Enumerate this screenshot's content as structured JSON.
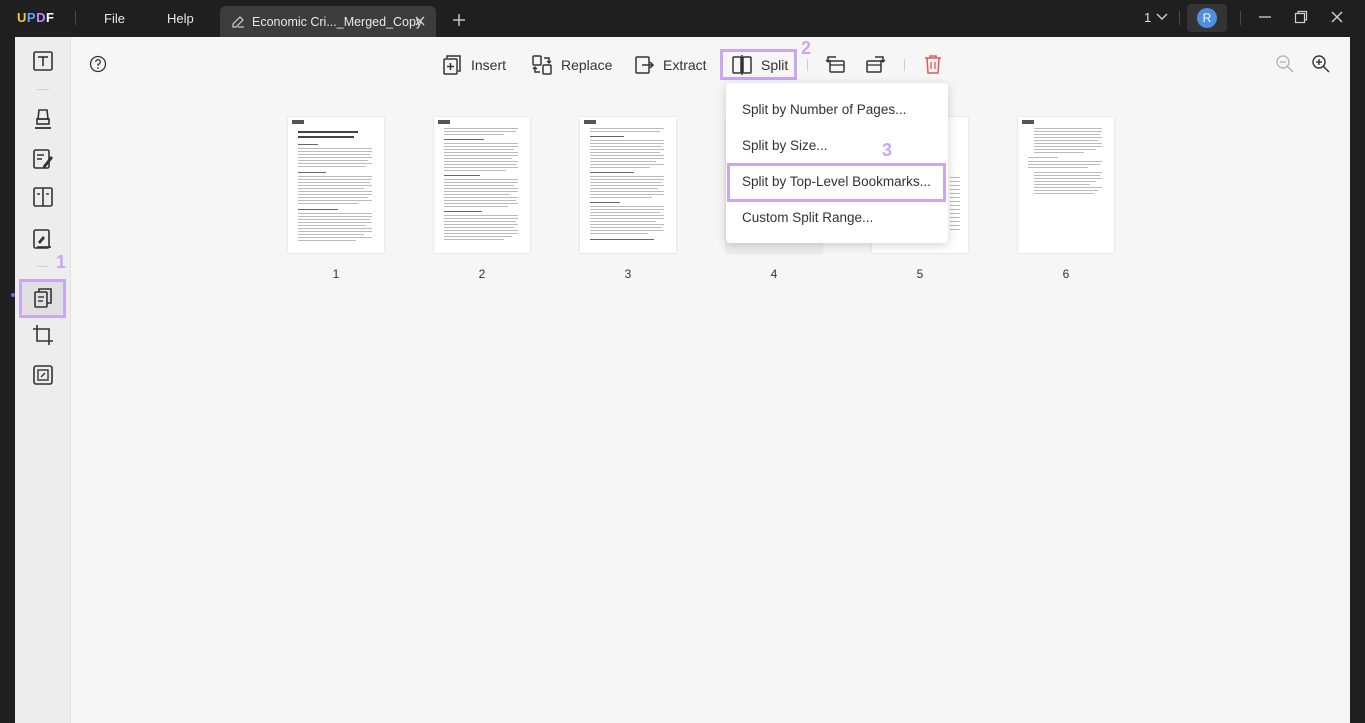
{
  "app": {
    "logo": [
      "U",
      "P",
      "D",
      "F"
    ]
  },
  "menu": {
    "file": "File",
    "help": "Help"
  },
  "tab": {
    "title": "Economic Cri..._Merged_Copy"
  },
  "window": {
    "page_count": "1",
    "avatar_letter": "R"
  },
  "toolbar": {
    "insert": "Insert",
    "replace": "Replace",
    "extract": "Extract",
    "split": "Split"
  },
  "split_menu": {
    "items": [
      "Split by Number of Pages...",
      "Split by Size...",
      "Split by Top-Level Bookmarks...",
      "Custom Split Range..."
    ]
  },
  "pages": [
    "1",
    "2",
    "3",
    "4",
    "5",
    "6"
  ],
  "page1": {
    "title": "Economic Crises of Bangladesh: Challenges and Opportunities"
  },
  "annotations": {
    "step1": "1",
    "step2": "2",
    "step3": "3"
  },
  "colors": {
    "highlight": "#c9a7f3",
    "accent": "#8a5cf0",
    "avatar": "#4e8fe0",
    "delete": "#e05a5a"
  }
}
